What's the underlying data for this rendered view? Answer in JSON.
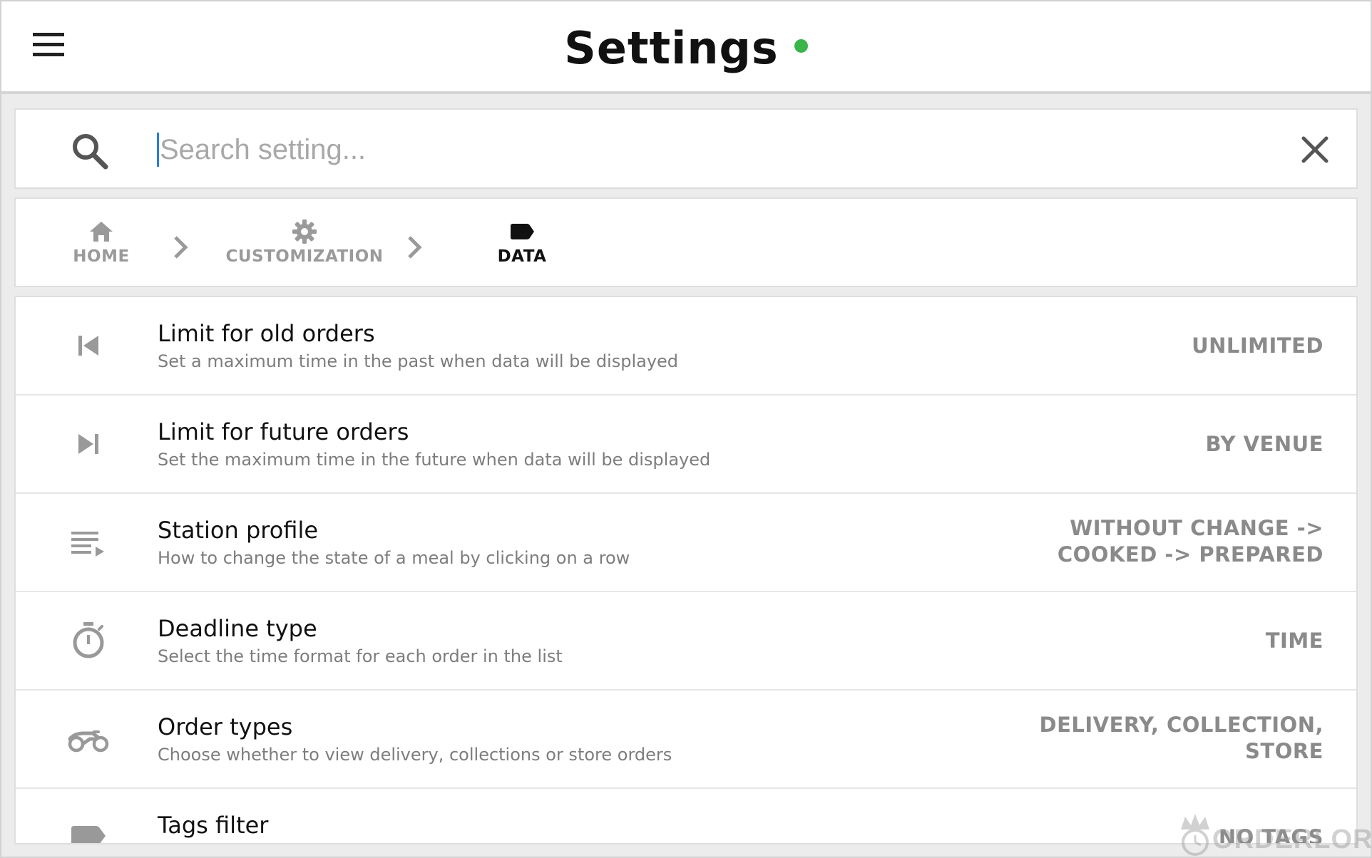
{
  "header": {
    "title": "Settings",
    "status_color": "#3bb44a",
    "menu_icon": "hamburger-menu-icon"
  },
  "search": {
    "placeholder": "Search setting...",
    "value": "",
    "search_icon": "search-icon",
    "clear_icon": "close-icon"
  },
  "breadcrumb": {
    "items": [
      {
        "label": "HOME",
        "icon": "home-icon",
        "active": false
      },
      {
        "label": "CUSTOMIZATION",
        "icon": "gear-icon",
        "active": false
      },
      {
        "label": "DATA",
        "icon": "tag-icon",
        "active": true
      }
    ],
    "separator_icon": "chevron-right-icon"
  },
  "settings": [
    {
      "title": "Limit for old orders",
      "description": "Set a maximum time in the past when data will be displayed",
      "value_lines": [
        "UNLIMITED"
      ],
      "icon": "skip-previous-icon"
    },
    {
      "title": "Limit for future orders",
      "description": "Set the maximum time in the future when data will be displayed",
      "value_lines": [
        "BY VENUE"
      ],
      "icon": "skip-next-icon"
    },
    {
      "title": "Station profile",
      "description": "How to change the state of a meal by clicking on a row",
      "value_lines": [
        "WITHOUT CHANGE ->",
        "COOKED -> PREPARED"
      ],
      "icon": "playlist-play-icon"
    },
    {
      "title": "Deadline type",
      "description": "Select the time format for each order in the list",
      "value_lines": [
        "TIME"
      ],
      "icon": "timer-icon"
    },
    {
      "title": "Order types",
      "description": "Choose whether to view delivery, collections or store orders",
      "value_lines": [
        "DELIVERY, COLLECTION,",
        "STORE"
      ],
      "icon": "motorbike-icon"
    },
    {
      "title": "Tags filter",
      "description": "",
      "value_lines": [
        "NO TAGS"
      ],
      "icon": "tag-icon"
    }
  ],
  "watermark": {
    "text": "ORDERLORD",
    "icon": "crown-clock-logo-icon"
  },
  "colors": {
    "background": "#ececec",
    "accent": "#3bb44a",
    "caret": "#2a7de1",
    "muted_text": "#8a8a8a"
  }
}
